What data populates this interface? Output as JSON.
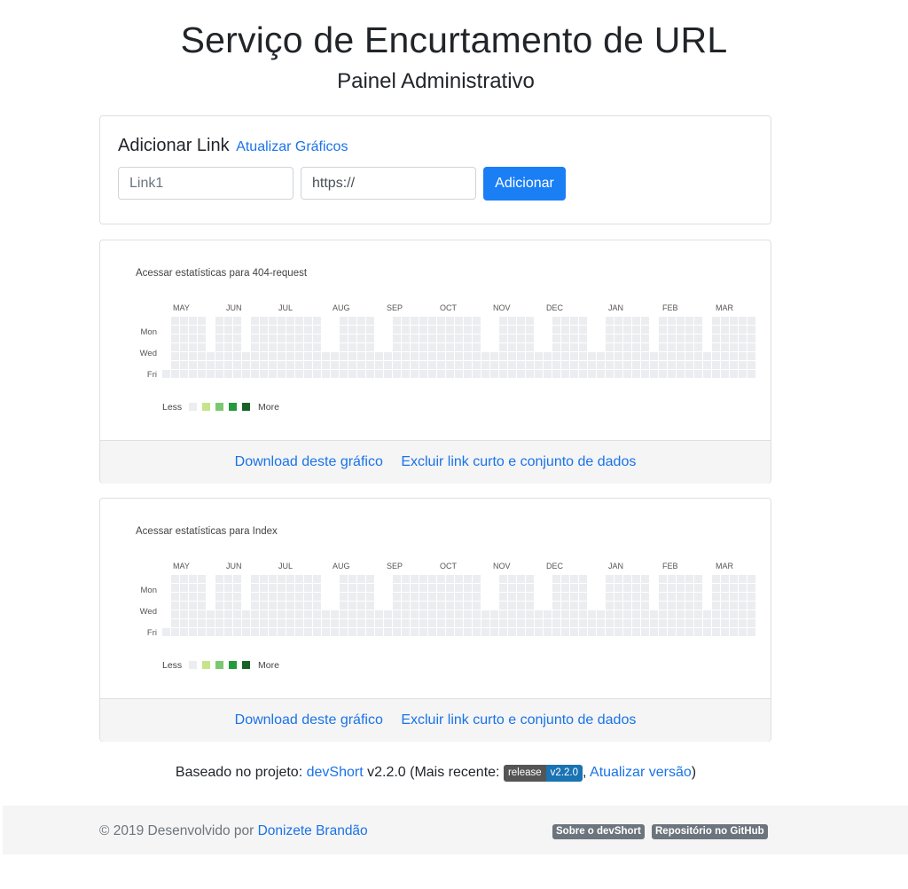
{
  "header": {
    "title": "Serviço de Encurtamento de URL",
    "subtitle": "Painel Administrativo"
  },
  "add_link": {
    "heading": "Adicionar Link",
    "refresh_link": "Atualizar Gráficos",
    "name_placeholder": "Link1",
    "url_value": "https://",
    "add_button": "Adicionar"
  },
  "stats_cards": [
    {
      "caption": "Acessar estatísticas para 404-request",
      "download_label": "Download deste gráfico",
      "delete_label": "Excluir link curto e conjunto de dados"
    },
    {
      "caption": "Acessar estatísticas para Index",
      "download_label": "Download deste gráfico",
      "delete_label": "Excluir link curto e conjunto de dados"
    }
  ],
  "heatmap": {
    "months": [
      "MAY",
      "JUN",
      "JUL",
      "AUG",
      "SEP",
      "OCT",
      "NOV",
      "DEC",
      "JAN",
      "FEB",
      "MAR"
    ],
    "days": [
      "Mon",
      "Wed",
      "Fri"
    ],
    "legend_less": "Less",
    "legend_more": "More",
    "colors": {
      "empty": "#ebedf0",
      "scale": [
        "#ebedf0",
        "#c6e48b",
        "#7bc96f",
        "#239a3b",
        "#196127"
      ]
    }
  },
  "footnote": {
    "prefix": "Baseado no projeto:",
    "project_link": "devShort",
    "version": "v2.2.0 (Mais recente:",
    "badge_left": "release",
    "badge_right": "v2.2.0",
    "comma": ",",
    "update_link": "Atualizar versão",
    "suffix": ")"
  },
  "footer": {
    "copyright": "© 2019 Desenvolvido por",
    "author": "Donizete Brandão",
    "badge_about": "Sobre o devShort",
    "badge_repo": "Repositório no GitHub"
  }
}
